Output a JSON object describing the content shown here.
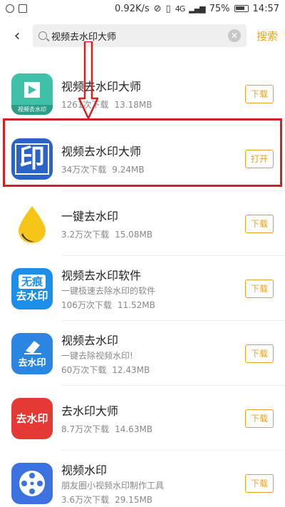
{
  "status_bar": {
    "network_speed": "0.92K/s",
    "battery": "75%",
    "time": "14:57",
    "signal_label": "4G"
  },
  "search": {
    "value": "视频去水印大师",
    "button_label": "搜索",
    "clear_glyph": "✕"
  },
  "apps": [
    {
      "name": "视频去水印大师",
      "desc": "",
      "downloads": "1261次下载",
      "size": "13.18MB",
      "action": "下载",
      "icon_caption": "视频去水印"
    },
    {
      "name": "视频去水印大师",
      "desc": "",
      "downloads": "34万次下载",
      "size": "9.24MB",
      "action": "打开",
      "icon_text": "印"
    },
    {
      "name": "一键去水印",
      "desc": "",
      "downloads": "3.2万次下载",
      "size": "15.08MB",
      "action": "下载"
    },
    {
      "name": "视频去水印软件",
      "desc": "一键极速去除水印的软件",
      "downloads": "106万次下载",
      "size": "11.52MB",
      "action": "下载",
      "icon_text_top": "无痕",
      "icon_text_bottom": "去水印"
    },
    {
      "name": "视频去水印",
      "desc": "一键去除视频水印!",
      "downloads": "60万次下载",
      "size": "12.43MB",
      "action": "下载",
      "icon_text": "去水印"
    },
    {
      "name": "去水印大师",
      "desc": "",
      "downloads": "8.7万次下载",
      "size": "14.63MB",
      "action": "下载",
      "icon_text": "去水印"
    },
    {
      "name": "视频水印",
      "desc": "朋友圈小视频水印制作工具",
      "downloads": "3.6万次下载",
      "size": "29.15MB",
      "action": "下载"
    }
  ],
  "colors": {
    "accent": "#f0a020",
    "highlight": "#d42020"
  }
}
